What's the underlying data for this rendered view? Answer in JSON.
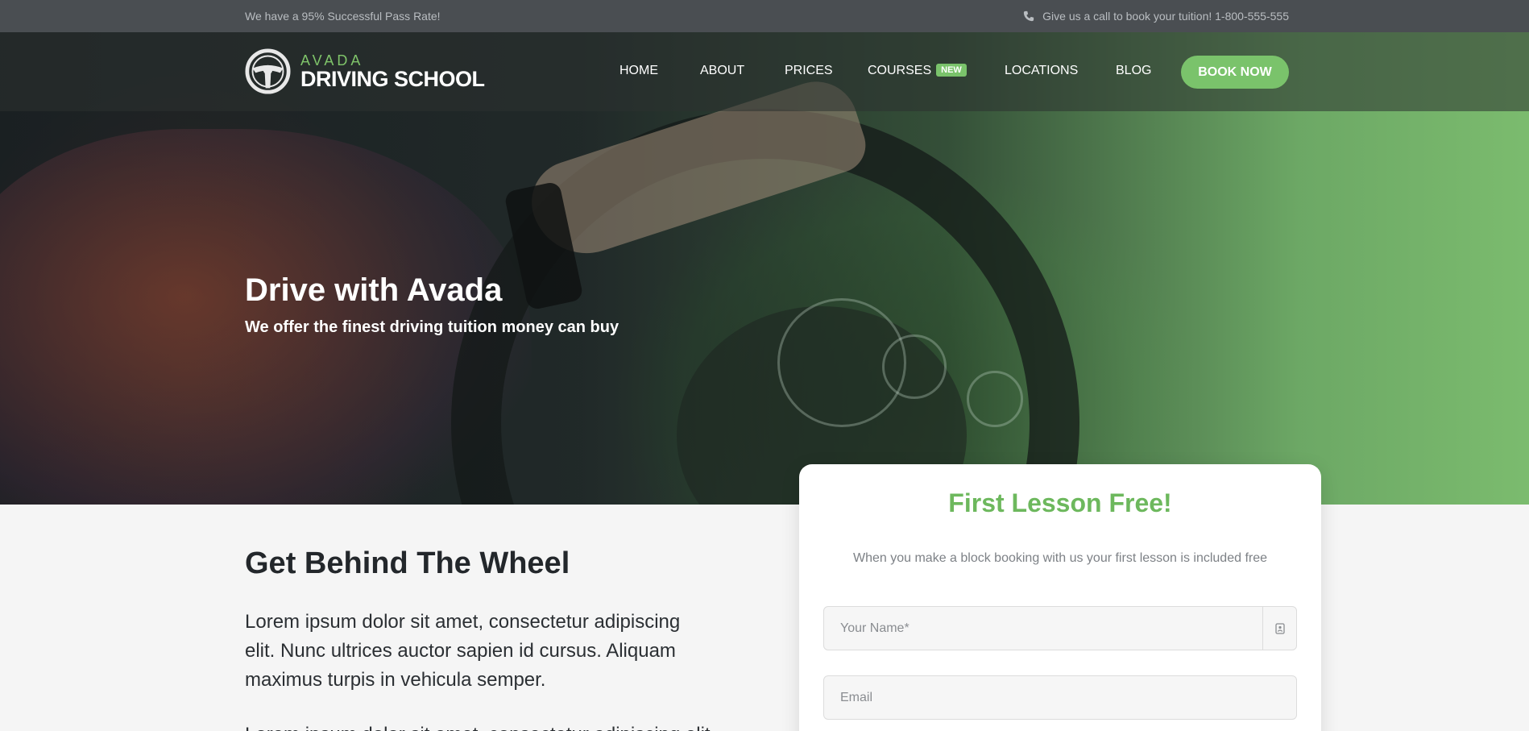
{
  "topbar": {
    "left_text": "We have a 95% Successful Pass Rate!",
    "phone_icon": "phone-icon",
    "right_text": "Give us a call to book your tuition! 1-800-555-555"
  },
  "header": {
    "logo": {
      "small": "AVADA",
      "big": "DRIVING SCHOOL",
      "icon": "steering-wheel-icon"
    },
    "nav": [
      {
        "label": "HOME"
      },
      {
        "label": "ABOUT"
      },
      {
        "label": "PRICES"
      },
      {
        "label": "COURSES",
        "badge": "NEW"
      },
      {
        "label": "LOCATIONS"
      },
      {
        "label": "BLOG"
      }
    ],
    "cta": "BOOK NOW"
  },
  "hero": {
    "title": "Drive with Avada",
    "subtitle": "We offer the finest driving tuition money can buy"
  },
  "content": {
    "title": "Get Behind The Wheel",
    "paragraph1": "Lorem ipsum dolor sit amet, consectetur adipiscing elit. Nunc ultrices auctor sapien id cursus. Aliquam maximus turpis in vehicula semper.",
    "paragraph2": "Lorem ipsum dolor sit amet, consectetur adipiscing elit. Nu"
  },
  "form_card": {
    "title": "First Lesson Free!",
    "subtitle": "When you make a block booking with us your first lesson is included free",
    "fields": [
      {
        "placeholder": "Your Name*",
        "value": "",
        "icon": "contact-card-icon"
      },
      {
        "placeholder": "Email",
        "value": ""
      }
    ]
  },
  "colors": {
    "accent": "#7ac36b",
    "topbar": "#4a4e52"
  }
}
